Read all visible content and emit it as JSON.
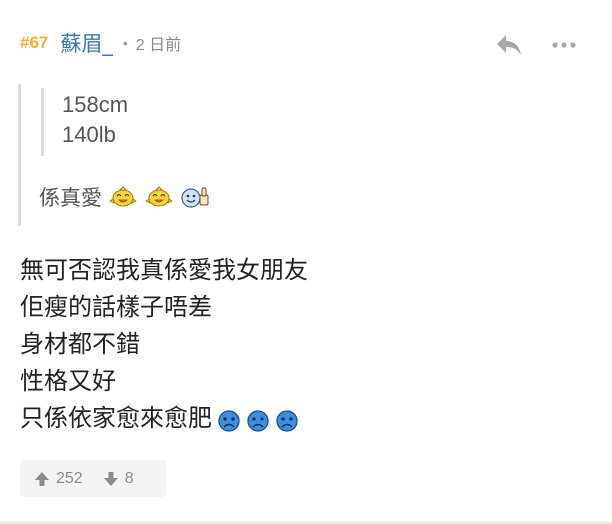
{
  "post": {
    "number": "#67",
    "username": "蘇眉_",
    "separator": "•",
    "timestamp": "2 日前",
    "icons": {
      "reply": "reply-icon",
      "more": "more-options-icon"
    }
  },
  "quote": {
    "nested_lines": [
      "158cm",
      "140lb"
    ],
    "text": "係真愛",
    "emojis": [
      "yellow-bird-emoji",
      "yellow-bird-emoji",
      "thumbs-up-smiley-emoji"
    ]
  },
  "body": {
    "lines": [
      "無可否認我真係愛我女朋友",
      "佢瘦的話樣子唔差",
      "身材都不錯",
      "性格又好",
      "只係依家愈來愈肥"
    ],
    "trailing_emojis": [
      "sad-face-emoji",
      "sad-face-emoji",
      "sad-face-emoji"
    ]
  },
  "votes": {
    "upvotes": "252",
    "downvotes": "8"
  },
  "colors": {
    "post_number": "#f0b030",
    "username": "#3a79a8",
    "meta": "#8a8a8a",
    "quote_border": "#dcdcdc",
    "vote_bg": "#f4f4f4",
    "sad_face": "#2d7fcf"
  }
}
